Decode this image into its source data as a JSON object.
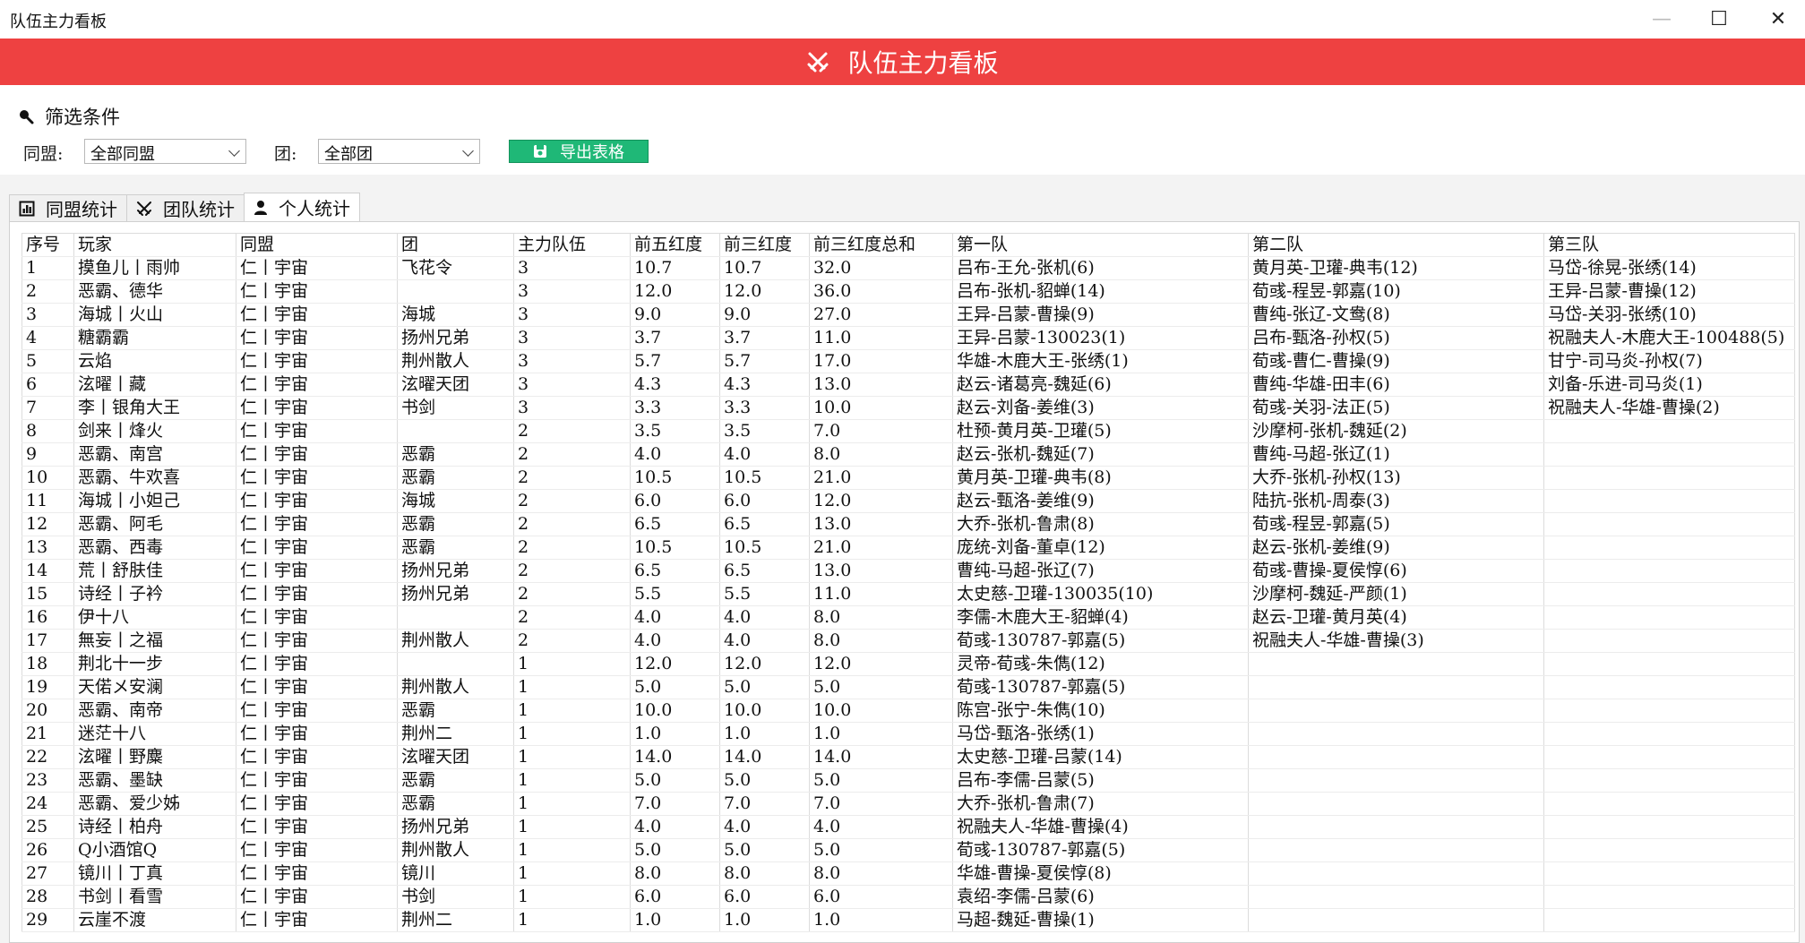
{
  "window": {
    "title": "队伍主力看板",
    "controls": {
      "minimize": "—",
      "maximize": "☐",
      "close": "✕"
    }
  },
  "banner": {
    "title": "队伍主力看板",
    "icon": "crossed-swords-icon"
  },
  "filters": {
    "heading": "筛选条件",
    "alliance_label": "同盟:",
    "alliance_value": "全部同盟",
    "group_label": "团:",
    "group_value": "全部团",
    "export_label": "导出表格"
  },
  "tabs": [
    {
      "label": "同盟统计",
      "icon": "bar-chart-icon",
      "active": false
    },
    {
      "label": "团队统计",
      "icon": "crossed-swords-icon",
      "active": false
    },
    {
      "label": "个人统计",
      "icon": "person-icon",
      "active": true
    }
  ],
  "colors": {
    "banner": "#ee4141",
    "export": "#1fb877"
  },
  "table": {
    "columns": [
      "序号",
      "玩家",
      "同盟",
      "团",
      "主力队伍",
      "前五红度",
      "前三红度",
      "前三红度总和",
      "第一队",
      "第二队",
      "第三队"
    ],
    "rows": [
      [
        "1",
        "摸鱼儿丨雨帅",
        "仁丨宇宙",
        "飞花令",
        "3",
        "10.7",
        "10.7",
        "32.0",
        "吕布-王允-张机(6)",
        "黄月英-卫瓘-典韦(12)",
        "马岱-徐晃-张绣(14)"
      ],
      [
        "2",
        "恶霸、德华",
        "仁丨宇宙",
        "",
        "3",
        "12.0",
        "12.0",
        "36.0",
        "吕布-张机-貂蝉(14)",
        "荀彧-程昱-郭嘉(10)",
        "王异-吕蒙-曹操(12)"
      ],
      [
        "3",
        "海城丨火山",
        "仁丨宇宙",
        "海城",
        "3",
        "9.0",
        "9.0",
        "27.0",
        "王异-吕蒙-曹操(9)",
        "曹纯-张辽-文鸯(8)",
        "马岱-关羽-张绣(10)"
      ],
      [
        "4",
        "糖霸霸",
        "仁丨宇宙",
        "扬州兄弟",
        "3",
        "3.7",
        "3.7",
        "11.0",
        "王异-吕蒙-130023(1)",
        "吕布-甄洛-孙权(5)",
        "祝融夫人-木鹿大王-100488(5)"
      ],
      [
        "5",
        "云焰",
        "仁丨宇宙",
        "荆州散人",
        "3",
        "5.7",
        "5.7",
        "17.0",
        "华雄-木鹿大王-张绣(1)",
        "荀彧-曹仁-曹操(9)",
        "甘宁-司马炎-孙权(7)"
      ],
      [
        "6",
        "泫曜丨藏",
        "仁丨宇宙",
        "泫曜天团",
        "3",
        "4.3",
        "4.3",
        "13.0",
        "赵云-诸葛亮-魏延(6)",
        "曹纯-华雄-田丰(6)",
        "刘备-乐进-司马炎(1)"
      ],
      [
        "7",
        "李丨银角大王",
        "仁丨宇宙",
        "书剑",
        "3",
        "3.3",
        "3.3",
        "10.0",
        "赵云-刘备-姜维(3)",
        "荀彧-关羽-法正(5)",
        "祝融夫人-华雄-曹操(2)"
      ],
      [
        "8",
        "剑来丨烽火",
        "仁丨宇宙",
        "",
        "2",
        "3.5",
        "3.5",
        "7.0",
        "杜预-黄月英-卫瓘(5)",
        "沙摩柯-张机-魏延(2)",
        ""
      ],
      [
        "9",
        "恶霸、南宫",
        "仁丨宇宙",
        "恶霸",
        "2",
        "4.0",
        "4.0",
        "8.0",
        "赵云-张机-魏延(7)",
        "曹纯-马超-张辽(1)",
        ""
      ],
      [
        "10",
        "恶霸、牛欢喜",
        "仁丨宇宙",
        "恶霸",
        "2",
        "10.5",
        "10.5",
        "21.0",
        "黄月英-卫瓘-典韦(8)",
        "大乔-张机-孙权(13)",
        ""
      ],
      [
        "11",
        "海城丨小妲己",
        "仁丨宇宙",
        "海城",
        "2",
        "6.0",
        "6.0",
        "12.0",
        "赵云-甄洛-姜维(9)",
        "陆抗-张机-周泰(3)",
        ""
      ],
      [
        "12",
        "恶霸、阿毛",
        "仁丨宇宙",
        "恶霸",
        "2",
        "6.5",
        "6.5",
        "13.0",
        "大乔-张机-鲁肃(8)",
        "荀彧-程昱-郭嘉(5)",
        ""
      ],
      [
        "13",
        "恶霸、西毒",
        "仁丨宇宙",
        "恶霸",
        "2",
        "10.5",
        "10.5",
        "21.0",
        "庞统-刘备-董卓(12)",
        "赵云-张机-姜维(9)",
        ""
      ],
      [
        "14",
        "荒丨舒肤佳",
        "仁丨宇宙",
        "扬州兄弟",
        "2",
        "6.5",
        "6.5",
        "13.0",
        "曹纯-马超-张辽(7)",
        "荀彧-曹操-夏侯惇(6)",
        ""
      ],
      [
        "15",
        "诗经丨子衿",
        "仁丨宇宙",
        "扬州兄弟",
        "2",
        "5.5",
        "5.5",
        "11.0",
        "太史慈-卫瓘-130035(10)",
        "沙摩柯-魏延-严颜(1)",
        ""
      ],
      [
        "16",
        "伊十八",
        "仁丨宇宙",
        "",
        "2",
        "4.0",
        "4.0",
        "8.0",
        "李儒-木鹿大王-貂蝉(4)",
        "赵云-卫瓘-黄月英(4)",
        ""
      ],
      [
        "17",
        "無妄丨之福",
        "仁丨宇宙",
        "荆州散人",
        "2",
        "4.0",
        "4.0",
        "8.0",
        "荀彧-130787-郭嘉(5)",
        "祝融夫人-华雄-曹操(3)",
        ""
      ],
      [
        "18",
        "荆北十一步",
        "仁丨宇宙",
        "",
        "1",
        "12.0",
        "12.0",
        "12.0",
        "灵帝-荀彧-朱儁(12)",
        "",
        ""
      ],
      [
        "19",
        "天偌メ安澜",
        "仁丨宇宙",
        "荆州散人",
        "1",
        "5.0",
        "5.0",
        "5.0",
        "荀彧-130787-郭嘉(5)",
        "",
        ""
      ],
      [
        "20",
        "恶霸、南帝",
        "仁丨宇宙",
        "恶霸",
        "1",
        "10.0",
        "10.0",
        "10.0",
        "陈宫-张宁-朱儁(10)",
        "",
        ""
      ],
      [
        "21",
        "迷茫十八",
        "仁丨宇宙",
        "荆州二",
        "1",
        "1.0",
        "1.0",
        "1.0",
        "马岱-甄洛-张绣(1)",
        "",
        ""
      ],
      [
        "22",
        "泫曜丨野麋",
        "仁丨宇宙",
        "泫曜天团",
        "1",
        "14.0",
        "14.0",
        "14.0",
        "太史慈-卫瓘-吕蒙(14)",
        "",
        ""
      ],
      [
        "23",
        "恶霸、墨缺",
        "仁丨宇宙",
        "恶霸",
        "1",
        "5.0",
        "5.0",
        "5.0",
        "吕布-李儒-吕蒙(5)",
        "",
        ""
      ],
      [
        "24",
        "恶霸、爱少姊",
        "仁丨宇宙",
        "恶霸",
        "1",
        "7.0",
        "7.0",
        "7.0",
        "大乔-张机-鲁肃(7)",
        "",
        ""
      ],
      [
        "25",
        "诗经丨柏舟",
        "仁丨宇宙",
        "扬州兄弟",
        "1",
        "4.0",
        "4.0",
        "4.0",
        "祝融夫人-华雄-曹操(4)",
        "",
        ""
      ],
      [
        "26",
        "Q小酒馆Q",
        "仁丨宇宙",
        "荆州散人",
        "1",
        "5.0",
        "5.0",
        "5.0",
        "荀彧-130787-郭嘉(5)",
        "",
        ""
      ],
      [
        "27",
        "镜川丨丁真",
        "仁丨宇宙",
        "镜川",
        "1",
        "8.0",
        "8.0",
        "8.0",
        "华雄-曹操-夏侯惇(8)",
        "",
        ""
      ],
      [
        "28",
        "书剑丨看雪",
        "仁丨宇宙",
        "书剑",
        "1",
        "6.0",
        "6.0",
        "6.0",
        "袁绍-李儒-吕蒙(6)",
        "",
        ""
      ],
      [
        "29",
        "云崖不渡",
        "仁丨宇宙",
        "荆州二",
        "1",
        "1.0",
        "1.0",
        "1.0",
        "马超-魏延-曹操(1)",
        "",
        ""
      ]
    ]
  }
}
